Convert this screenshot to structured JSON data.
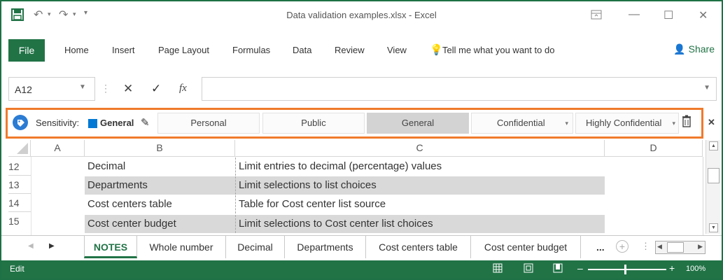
{
  "window": {
    "title": "Data validation examples.xlsx - Excel"
  },
  "ribbon": {
    "file": "File",
    "tabs": [
      "Home",
      "Insert",
      "Page Layout",
      "Formulas",
      "Data",
      "Review",
      "View"
    ],
    "tell_me": "Tell me what you want to do",
    "share": "Share"
  },
  "formula_bar": {
    "name_box": "A12",
    "fx": "fx",
    "value": ""
  },
  "sensitivity": {
    "label": "Sensitivity:",
    "current": "General",
    "options": [
      "Personal",
      "Public",
      "General",
      "Confidential",
      "Highly Confidential"
    ]
  },
  "grid": {
    "columns": [
      "A",
      "B",
      "C",
      "D"
    ],
    "rows": [
      {
        "num": "12",
        "b": "Decimal",
        "c": "Limit entries to decimal (percentage) values",
        "shaded": false
      },
      {
        "num": "13",
        "b": "Departments",
        "c": "Limit selections to list choices",
        "shaded": true
      },
      {
        "num": "14",
        "b": "Cost centers table",
        "c": "Table for Cost center list source",
        "shaded": false
      },
      {
        "num": "15",
        "b": "Cost center budget",
        "c": "Limit selections to Cost center list choices",
        "shaded": true
      }
    ]
  },
  "sheet_tabs": {
    "tabs": [
      "NOTES",
      "Whole number",
      "Decimal",
      "Departments",
      "Cost centers table",
      "Cost center budget"
    ],
    "more": "..."
  },
  "status_bar": {
    "mode": "Edit",
    "zoom": "100%"
  },
  "colors": {
    "excel_green": "#217346",
    "sensitivity_border": "#f07a2b",
    "selected_label": "#0078d4"
  }
}
